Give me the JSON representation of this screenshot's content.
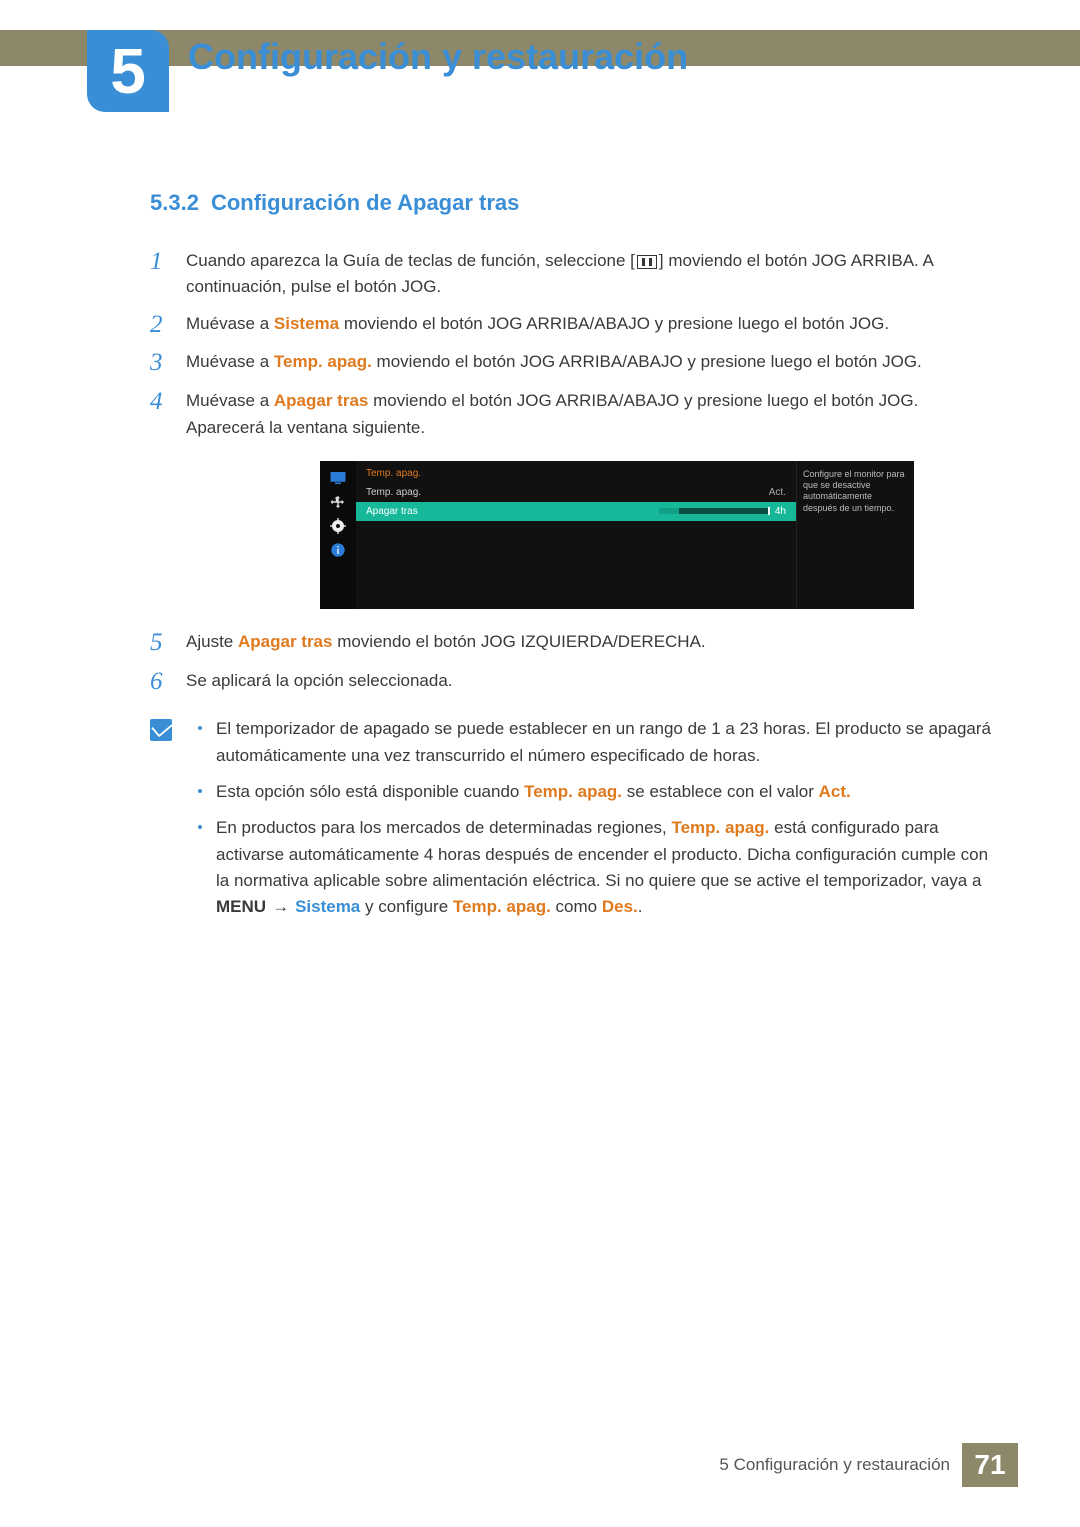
{
  "chapter": {
    "number": "5",
    "title": "Configuración y restauración"
  },
  "section": {
    "number": "5.3.2",
    "title": "Configuración de Apagar tras"
  },
  "steps": {
    "s1a": "Cuando aparezca la Guía de teclas de función, seleccione [",
    "s1b": "] moviendo el botón JOG ARRIBA. A continuación, pulse el botón JOG.",
    "s2a": "Muévase a ",
    "s2_sistema": "Sistema",
    "s2b": " moviendo el botón JOG ARRIBA/ABAJO y presione luego el botón JOG.",
    "s3a": "Muévase a ",
    "s3_temp": "Temp. apag.",
    "s3b": " moviendo el botón JOG ARRIBA/ABAJO y presione luego el botón JOG.",
    "s4a": "Muévase a ",
    "s4_apagar": "Apagar tras",
    "s4b": " moviendo el botón JOG ARRIBA/ABAJO y presione luego el botón JOG. Aparecerá la ventana siguiente.",
    "s5a": "Ajuste ",
    "s5_apagar": "Apagar tras",
    "s5b": " moviendo el botón JOG IZQUIERDA/DERECHA.",
    "s6": "Se aplicará la opción seleccionada."
  },
  "osd": {
    "title": "Temp. apag.",
    "row1_label": "Temp. apag.",
    "row1_value": "Act.",
    "row2_label": "Apagar tras",
    "row2_value": "4h",
    "tip": "Configure el monitor para que se desactive automáticamente después de un tiempo."
  },
  "notes": {
    "n1": "El temporizador de apagado se puede establecer en un rango de 1 a 23 horas. El producto se apagará automáticamente una vez transcurrido el número especificado de horas.",
    "n2a": "Esta opción sólo está disponible cuando ",
    "n2_temp": "Temp. apag.",
    "n2b": " se establece con el valor ",
    "n2_act": "Act.",
    "n3a": "En productos para los mercados de determinadas regiones, ",
    "n3_temp": "Temp. apag.",
    "n3b": " está configurado para activarse automáticamente 4 horas después de encender el producto. Dicha configuración cumple con la normativa aplicable sobre alimentación eléctrica. Si no quiere que se active el temporizador, vaya a ",
    "n3_menu": "MENU",
    "n3_arrow": "→",
    "n3_sistema": "Sistema",
    "n3c": " y configure ",
    "n3_temp2": "Temp. apag.",
    "n3d": " como ",
    "n3_des": "Des.",
    "n3e": "."
  },
  "footer": {
    "text": "5 Configuración y restauración",
    "page": "71"
  }
}
